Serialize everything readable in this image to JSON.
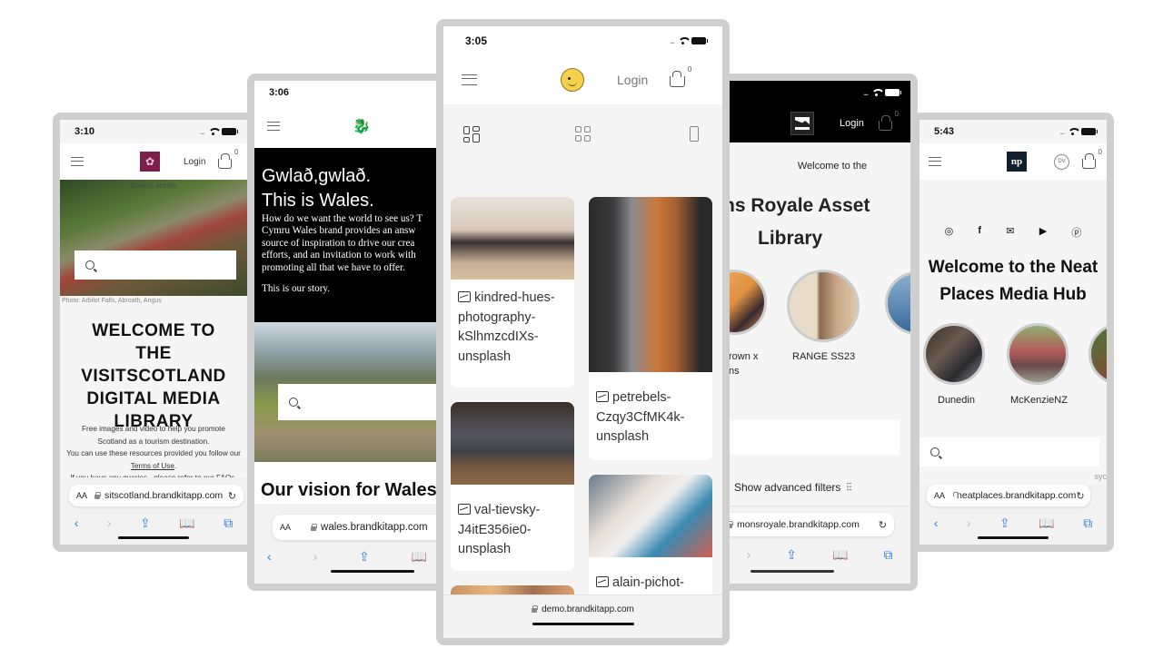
{
  "phones": {
    "scotland": {
      "time": "3:10",
      "login": "Login",
      "cart_count": "0",
      "search_ghost": "Search assets",
      "photo_caption": "Photo: Arbilot Falls, Abroath, Angus",
      "title": "WELCOME TO THE VISITSCOTLAND DIGITAL MEDIA LIBRARY",
      "desc_line1": "Free images and video to help you promote Scotland as a tourism destination.",
      "desc_line2": "You can use these resources provided you follow our",
      "terms_link": "Terms of Use",
      "desc_line3": "If you have any queries - please refer to our",
      "faqs_link": "FAQs",
      "aa": "AA",
      "url": "sitscotland.brandkitapp.com"
    },
    "wales": {
      "time": "3:06",
      "headline1": "Gwlað,gwlað.",
      "headline2": "This is Wales.",
      "body_lines": [
        "How do we want the world to see us? T",
        "Cymru Wales brand provides an answ",
        "source of inspiration to drive our crea",
        "efforts, and an invitation to work with",
        "promoting all that we have to offer."
      ],
      "story": "This is our story.",
      "vision": "Our vision for Wales",
      "aa": "AA",
      "url": "wales.brandkitapp.com"
    },
    "demo": {
      "time": "3:05",
      "login": "Login",
      "cart_count": "0",
      "view_modes": [
        "masonry-view",
        "grid-view",
        "single-view"
      ],
      "cards": [
        {
          "name": "kindred-hues-photography-kSlhmzcdIXs-unsplash",
          "lines": [
            "kindred-hues-",
            "photography-",
            "kSlhmzcdIXs-",
            "unsplash"
          ]
        },
        {
          "name": "petrebels-Czqy3CfMK4k-unsplash",
          "lines": [
            "petrebels-",
            "Czqy3CfMK4k-",
            "unsplash"
          ]
        },
        {
          "name": "val-tievsky-J4itE356ie0-unsplash",
          "lines": [
            "val-tievsky-",
            "J4itE356ie0-",
            "unsplash"
          ]
        },
        {
          "name": "alain-pichot-",
          "lines": [
            "alain-pichot-"
          ]
        }
      ],
      "url": "demo.brandkitapp.com"
    },
    "mons": {
      "login": "Login",
      "cart_count": "0",
      "welcome": "Welcome to the",
      "title1": "ns Royale Asset",
      "title2": "Library",
      "collections": [
        "rown x ns",
        "RANGE SS23",
        ""
      ],
      "collection_line1": "rown x",
      "collection_line2": "ns",
      "advanced": "Show advanced filters",
      "url": "monsroyale.brandkitapp.com"
    },
    "neat": {
      "time": "5:43",
      "logo": "np",
      "avatar": "DV",
      "cart_count": "0",
      "social": [
        "instagram",
        "facebook",
        "email",
        "youtube",
        "pinterest"
      ],
      "title": "Welcome to the Neat Places Media Hub",
      "collections": [
        "Dunedin",
        "McKenzieNZ"
      ],
      "partial": "syc",
      "aa": "AA",
      "url": "neatplaces.brandkitapp.com"
    }
  }
}
